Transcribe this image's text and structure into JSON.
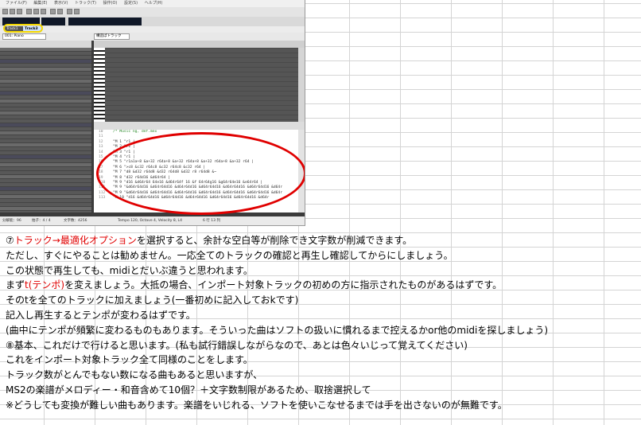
{
  "app": {
    "menu": [
      "ファイル(F)",
      "編集(E)",
      "表示(V)",
      "トラック(T)",
      "操作(O)",
      "設定(S)",
      "ヘルプ(H)"
    ],
    "tabs": [
      {
        "label": "Track1"
      },
      {
        "label": "Track3"
      }
    ],
    "track_select": "001: Piano",
    "instrument_type": "構造ぱトラック",
    "mml_lines": [
      {
        "num": "10",
        "code": "/* Music ng, def.mex"
      },
      {
        "num": "11",
        "code": ""
      },
      {
        "num": "12",
        "code": "\"M 1  \"r1 |"
      },
      {
        "num": "13",
        "code": "\"M 2  \"r1 |"
      },
      {
        "num": "14",
        "code": "\"M 3  \"r1 |"
      },
      {
        "num": "15",
        "code": "\"M 4  \"r1 |"
      },
      {
        "num": "16",
        "code": "\"M 5  \"r1a1a+8 &a+32 r64a+8 &a+32 r64a+8 &a+32 r64a+8 &a+32 r64 |"
      },
      {
        "num": "17",
        "code": "\"M 6  \">c8 &c32 r64c8 &c32 r64c8 &c32 r64 |"
      },
      {
        "num": "18",
        "code": "\"M 7  \"d8 &d32 r64d8 &d32 r64d8 &d32 r8 r64d8 &~"
      },
      {
        "num": "19",
        "code": "\"M 8  \"d32 r64d16 &d64r64 |"
      },
      {
        "num": "110",
        "code": "\"M 9  \"d16 &d64r64 64e16 &d64r64f 16 &f 64r64g16 &g64r64e16 &e64r64 |"
      },
      {
        "num": "111",
        "code": "\"M 9  \"&d64r64d16 &d64r64d16 &d64r64d16 &d64r64d16 &d64r64d16 &d64r64d16 &d64r"
      },
      {
        "num": "112",
        "code": "\"M 9  \"&d64r64d16 &d64r64d16 &d64r64d16 &d64r64d16 &d64r64d16 &d64r64d16 &d64r"
      },
      {
        "num": "113",
        "code": "\"M 10 \"d16 &d64r64d16 &d64r64d16 &d64r64d16 &d64r64d16 &d64r64d16 &d64r"
      }
    ],
    "status": {
      "left": "分解能：96",
      "beat": "拍子：4 / 4",
      "chars": "文字数：4256",
      "tempo": "Tempo 120, Octave 4, Velocity 8, L4",
      "position": "6 行 13 列"
    }
  },
  "notes": [
    {
      "parts": [
        {
          "t": "⑦",
          "red": false
        },
        {
          "t": "トラック→最適化オプション",
          "red": true
        },
        {
          "t": "を選択すると、余計な空白等が削除でき文字数が削減できます。",
          "red": false
        }
      ]
    },
    {
      "parts": [
        {
          "t": "ただし、すぐにやることは勧めません。一応全てのトラックの確認と再生し確認してからにしましょう。",
          "red": false
        }
      ]
    },
    {
      "parts": [
        {
          "t": "この状態で再生しても、midiとだいぶ違うと思われます。",
          "red": false
        }
      ]
    },
    {
      "parts": [
        {
          "t": "まず",
          "red": false
        },
        {
          "t": "t(テンポ)",
          "red": true
        },
        {
          "t": "を変えましょう。大抵の場合、インポート対象トラックの初めの方に指示されたものがあるはずです。",
          "red": false
        }
      ]
    },
    {
      "parts": [
        {
          "t": "そのtを全てのトラックに加えましょう(一番初めに記入しておkです)",
          "red": false
        }
      ]
    },
    {
      "parts": [
        {
          "t": "記入し再生するとテンポが変わるはずです。",
          "red": false
        }
      ]
    },
    {
      "parts": [
        {
          "t": "(曲中にテンポが頻繁に変わるものもあります。そういった曲はソフトの扱いに慣れるまで控えるかor他のmidiを探しましょう)",
          "red": false
        }
      ]
    },
    {
      "parts": [
        {
          "t": "⑧基本、これだけで行けると思います。(私も試行錯誤しながらなので、あとは色々いじって覚えてください)",
          "red": false
        }
      ]
    },
    {
      "parts": [
        {
          "t": "これをインポート対象トラック全て同様のことをします。",
          "red": false
        }
      ]
    },
    {
      "parts": [
        {
          "t": "トラック数がとんでもない数になる曲もあると思いますが、",
          "red": false
        }
      ]
    },
    {
      "parts": [
        {
          "t": "MS2の楽譜がメロディー・和音含めて10個？＋文字数制限があるため、取捨選択して",
          "red": false
        }
      ]
    },
    {
      "parts": [
        {
          "t": "※どうしても変換が難しい曲もあります。楽譜をいじれる、ソフトを使いこなせるまでは手を出さないのが無難です。",
          "red": false
        }
      ]
    }
  ]
}
